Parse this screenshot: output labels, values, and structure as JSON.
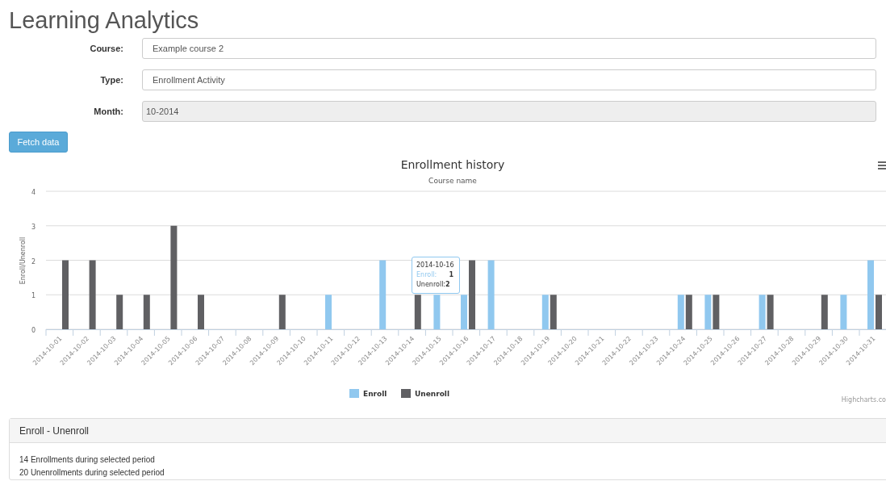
{
  "page_title": "Learning Analytics",
  "form": [
    {
      "label": "Course:",
      "value": "Example course 2",
      "disabled": false
    },
    {
      "label": "Type:",
      "value": "Enrollment Activity",
      "disabled": false
    },
    {
      "label": "Month:",
      "value": "10-2014",
      "disabled": true
    }
  ],
  "fetch_button": "Fetch data",
  "chart": {
    "subtitle": "Course name",
    "credit": "Highcharts.co",
    "chart_data": {
      "type": "bar",
      "grid": true,
      "legend": true,
      "title": "Enrollment history",
      "ylabel": "Enroll/Unenroll",
      "ylim": [
        0,
        4
      ],
      "yticks": [
        0,
        1,
        2,
        3,
        4
      ],
      "categories": [
        "2014-10-01",
        "2014-10-02",
        "2014-10-03",
        "2014-10-04",
        "2014-10-05",
        "2014-10-06",
        "2014-10-07",
        "2014-10-08",
        "2014-10-09",
        "2014-10-10",
        "2014-10-11",
        "2014-10-12",
        "2014-10-13",
        "2014-10-14",
        "2014-10-15",
        "2014-10-16",
        "2014-10-17",
        "2014-10-18",
        "2014-10-19",
        "2014-10-20",
        "2014-10-21",
        "2014-10-22",
        "2014-10-23",
        "2014-10-24",
        "2014-10-25",
        "2014-10-26",
        "2014-10-27",
        "2014-10-28",
        "2014-10-29",
        "2014-10-30",
        "2014-10-31"
      ],
      "series": [
        {
          "name": "Enroll",
          "color": "#90c8ef",
          "values": [
            0,
            0,
            0,
            0,
            0,
            0,
            0,
            0,
            0,
            0,
            1,
            0,
            2,
            0,
            1,
            1,
            2,
            0,
            1,
            0,
            0,
            0,
            0,
            1,
            1,
            0,
            1,
            0,
            0,
            1,
            2
          ]
        },
        {
          "name": "Unenroll",
          "color": "#606063",
          "values": [
            2,
            2,
            1,
            1,
            3,
            1,
            0,
            0,
            1,
            0,
            0,
            0,
            0,
            1,
            0,
            2,
            0,
            0,
            1,
            0,
            0,
            0,
            0,
            1,
            1,
            0,
            1,
            0,
            1,
            0,
            1
          ]
        }
      ]
    },
    "tooltip": {
      "title": "2014-10-16",
      "rows": [
        "Enroll:      **1**",
        "Unenroll:**2**"
      ]
    }
  },
  "summary_panel": {
    "title": "Enroll - Unenroll",
    "lines": [
      "14 Enrollments during selected period",
      "20 Unenrollments during selected period"
    ]
  }
}
